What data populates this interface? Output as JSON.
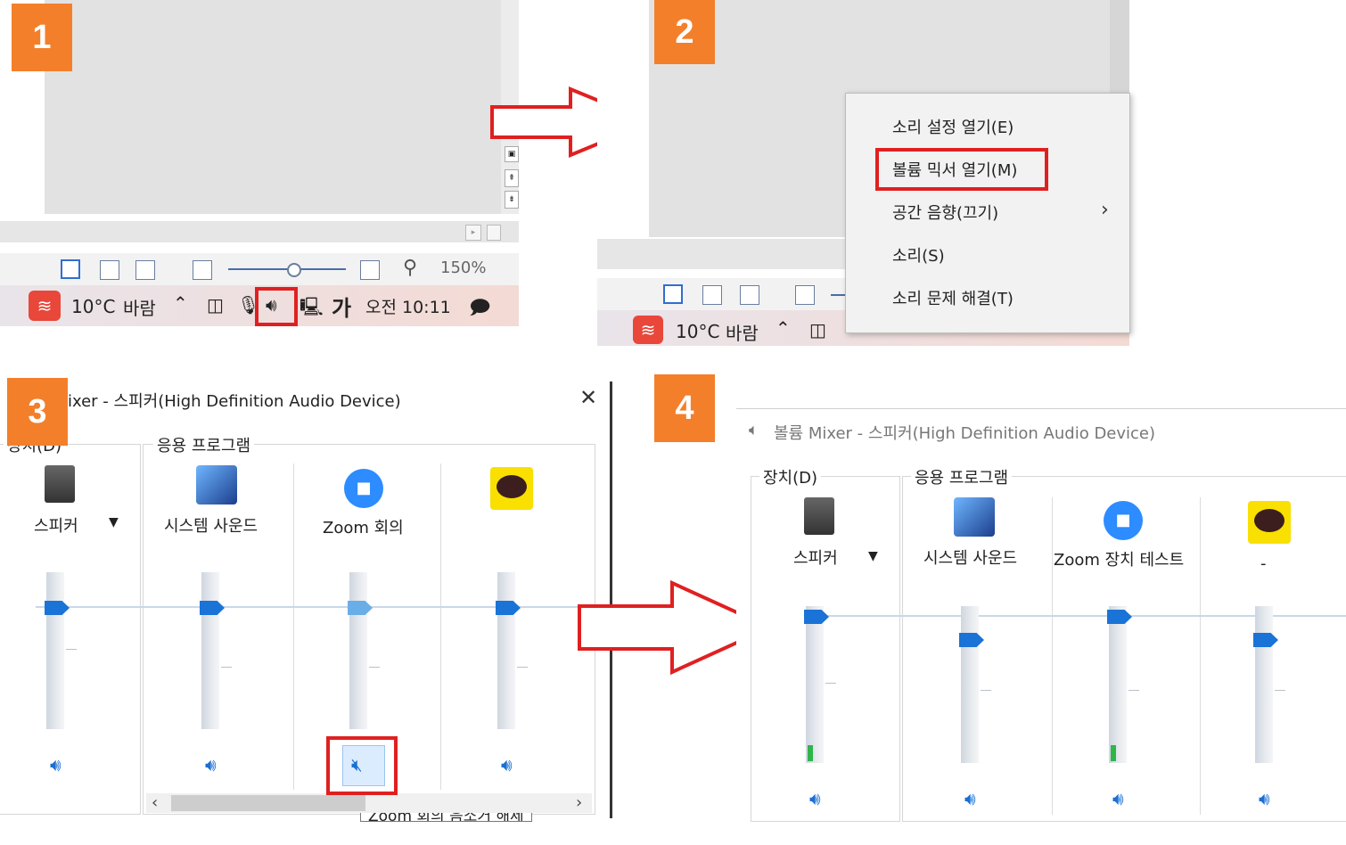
{
  "badges": [
    "1",
    "2",
    "3",
    "4"
  ],
  "panel1": {
    "zoom_level": "150%",
    "taskbar": {
      "weather_temp": "10°C",
      "weather_text": "바람",
      "ime_label": "가",
      "clock": "오전 10:11"
    }
  },
  "panel2": {
    "taskbar": {
      "weather_temp": "10°C",
      "weather_text": "바람"
    },
    "context_menu": [
      {
        "label": "소리 설정 열기(E)"
      },
      {
        "label": "볼륨 믹서 열기(M)"
      },
      {
        "label": "공간 음향(끄기)"
      },
      {
        "label": "소리(S)"
      },
      {
        "label": "소리 문제 해결(T)"
      }
    ]
  },
  "panel3": {
    "title": "ixer - 스피커(High Definition Audio Device)",
    "device_group": "장치(D)",
    "apps_group": "응용 프로그램",
    "channels": [
      {
        "name": "스피커",
        "level": 0.85,
        "muted": false
      },
      {
        "name": "시스템 사운드",
        "level": 0.85,
        "muted": false
      },
      {
        "name": "Zoom 회의",
        "level": 0.85,
        "muted": true
      },
      {
        "name": "",
        "level": 0.85,
        "muted": false
      }
    ],
    "tooltip": "Zoom 회의 음소거 해제"
  },
  "panel4": {
    "title": "볼륨 Mixer - 스피커(High Definition Audio Device)",
    "device_group": "장치(D)",
    "apps_group": "응용 프로그램",
    "channels": [
      {
        "name": "스피커",
        "level": 0.95,
        "muted": false
      },
      {
        "name": "시스템 사운드",
        "level": 0.8,
        "muted": false
      },
      {
        "name": "Zoom 장치 테스트",
        "level": 0.95,
        "muted": false
      },
      {
        "name": "-",
        "level": 0.8,
        "muted": false
      }
    ]
  },
  "colors": {
    "badge": "#f47f2a",
    "highlight": "#e02020",
    "accent": "#1a73d6"
  }
}
